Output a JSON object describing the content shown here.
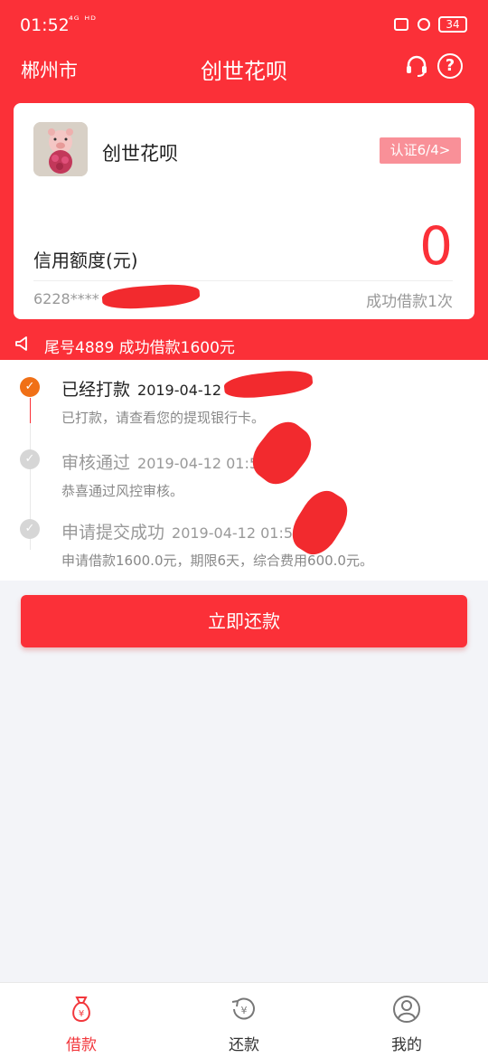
{
  "status_bar": {
    "time": "01:52",
    "network": "⁴ᴳ ᴴᴰ",
    "battery": "34"
  },
  "nav": {
    "city": "郴州市",
    "title": "创世花呗",
    "help": "?"
  },
  "card": {
    "name": "创世花呗",
    "auth_badge": "认证6/4>",
    "credit_label": "信用额度(元)",
    "amount": "0",
    "card_number": "6228****",
    "success_count": "成功借款1次"
  },
  "notice": {
    "text": "尾号4889 成功借款1600元"
  },
  "timeline": [
    {
      "title": "已经打款",
      "date": "2019-04-12 0",
      "desc": "已打款，请查看您的提现银行卡。",
      "state": "done"
    },
    {
      "title": "审核通过",
      "date": "2019-04-12 01:50",
      "desc": "恭喜通过风控审核。",
      "state": "pending"
    },
    {
      "title": "申请提交成功",
      "date": "2019-04-12 01:50",
      "desc": "申请借款1600.0元，期限6天，综合费用600.0元。",
      "state": "pending"
    }
  ],
  "repay_button": "立即还款",
  "tabs": [
    {
      "label": "借款",
      "icon": "money-bag-icon",
      "active": true
    },
    {
      "label": "还款",
      "icon": "repay-icon",
      "active": false
    },
    {
      "label": "我的",
      "icon": "user-icon",
      "active": false
    }
  ],
  "colors": {
    "brand": "#fb3038",
    "active_tab": "#f2373c",
    "step_done": "#f07017",
    "step_pending": "#d6d6d6"
  }
}
